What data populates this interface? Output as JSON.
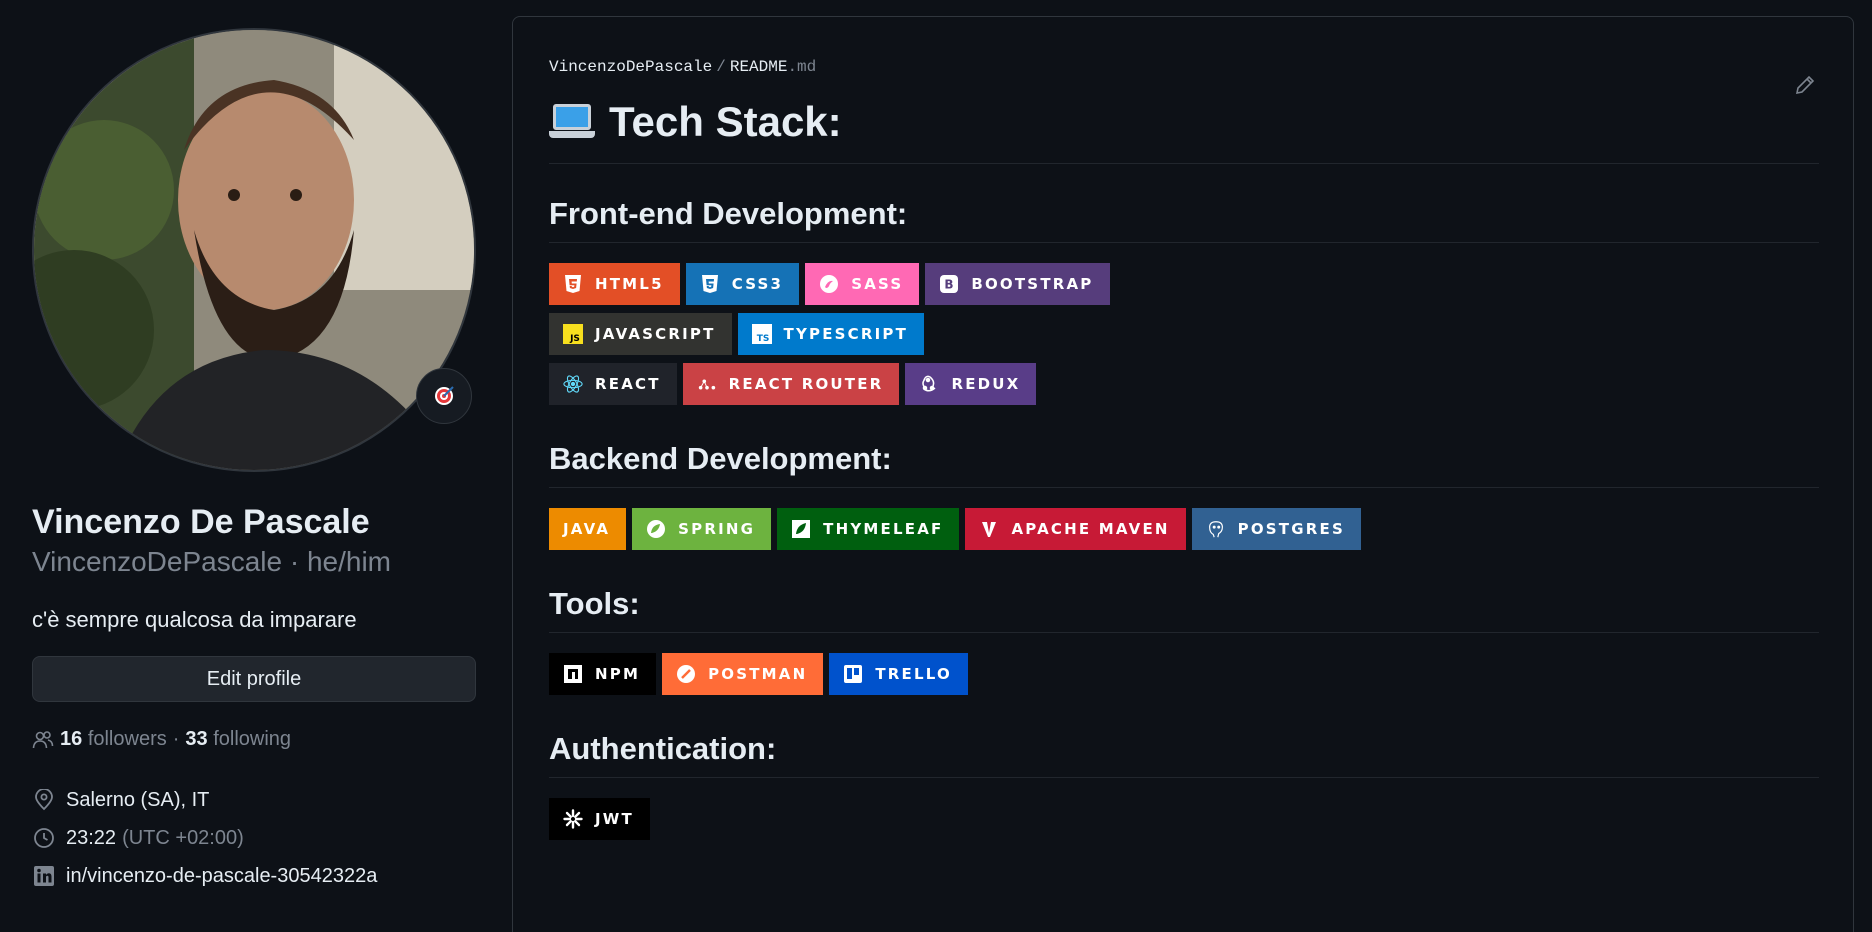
{
  "profile": {
    "name": "Vincenzo De Pascale",
    "login": "VincenzoDePascale · he/him",
    "bio": "c'è sempre qualcosa da imparare",
    "edit_label": "Edit profile",
    "followers_count": "16",
    "followers_label": "followers",
    "dot": "·",
    "following_count": "33",
    "following_label": "following",
    "location": "Salerno (SA), IT",
    "time": "23:22",
    "timezone": "(UTC +02:00)",
    "linkedin": "in/vincenzo-de-pascale-30542322a"
  },
  "readme": {
    "owner": "VincenzoDePascale",
    "separator": "/",
    "file_base": "README",
    "file_ext": ".md",
    "title": "Tech Stack:",
    "sections": [
      {
        "heading": "Front-end Development:",
        "rows": [
          [
            {
              "label": "HTML5",
              "color": "#e34f26",
              "icon": "html5-icon"
            },
            {
              "label": "CSS3",
              "color": "#1572b6",
              "icon": "css3-icon"
            },
            {
              "label": "SASS",
              "color": "#ff69b4",
              "icon": "sass-icon"
            },
            {
              "label": "BOOTSTRAP",
              "color": "#563d7c",
              "icon": "bootstrap-icon"
            }
          ],
          [
            {
              "label": "JAVASCRIPT",
              "color": "#323330",
              "icon": "javascript-icon"
            },
            {
              "label": "TYPESCRIPT",
              "color": "#007acc",
              "icon": "typescript-icon"
            }
          ],
          [
            {
              "label": "REACT",
              "color": "#20232a",
              "icon": "react-icon"
            },
            {
              "label": "REACT ROUTER",
              "color": "#ca4245",
              "icon": "react-router-icon"
            },
            {
              "label": "REDUX",
              "color": "#593d88",
              "icon": "redux-icon"
            }
          ]
        ]
      },
      {
        "heading": "Backend Development:",
        "rows": [
          [
            {
              "label": "JAVA",
              "color": "#ed8b00",
              "icon": "none"
            },
            {
              "label": "SPRING",
              "color": "#6db33f",
              "icon": "spring-icon"
            },
            {
              "label": "THYMELEAF",
              "color": "#005f0f",
              "icon": "thymeleaf-icon"
            },
            {
              "label": "APACHE MAVEN",
              "color": "#c71a36",
              "icon": "maven-icon"
            },
            {
              "label": "POSTGRES",
              "color": "#316192",
              "icon": "postgres-icon"
            }
          ]
        ]
      },
      {
        "heading": "Tools:",
        "rows": [
          [
            {
              "label": "NPM",
              "color": "#000000",
              "icon": "npm-icon"
            },
            {
              "label": "POSTMAN",
              "color": "#ff6c37",
              "icon": "postman-icon"
            },
            {
              "label": "TRELLO",
              "color": "#0052cc",
              "icon": "trello-icon"
            }
          ]
        ]
      },
      {
        "heading": "Authentication:",
        "rows": [
          [
            {
              "label": "JWT",
              "color": "#000000",
              "icon": "jwt-icon"
            }
          ]
        ]
      }
    ]
  }
}
